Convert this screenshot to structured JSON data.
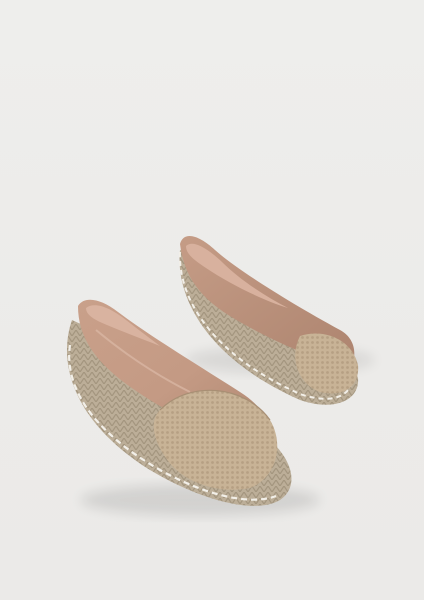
{
  "photo": {
    "subject_icon": "espadrille-pair-icon",
    "colors": {
      "background": "#ededeb",
      "leather": "#c49a84",
      "leather_shadow": "#a8806c",
      "lining": "#d9b3a0",
      "jute_toe": "#cbb79a",
      "rope_sole": "#b9aa93",
      "stitch": "#f2efe8"
    }
  }
}
